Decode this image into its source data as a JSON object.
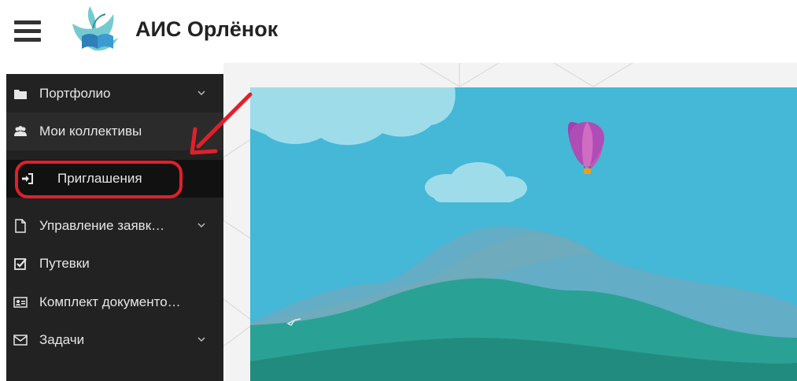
{
  "header": {
    "title": "АИС Орлёнок",
    "menu_icon": "hamburger-icon",
    "logo_icon": "app-logo-icon"
  },
  "sidebar": {
    "items": [
      {
        "label": "Портфолио",
        "icon": "folder-icon",
        "expandable": true
      },
      {
        "label": "Мои коллективы",
        "icon": "users-icon",
        "expandable": false
      },
      {
        "label": "Приглашения",
        "icon": "sign-in-icon",
        "expandable": false
      },
      {
        "label": "Управление заявк…",
        "icon": "file-icon",
        "expandable": true
      },
      {
        "label": "Путевки",
        "icon": "checkbox-icon",
        "expandable": false
      },
      {
        "label": "Комплект документо…",
        "icon": "id-card-icon",
        "expandable": false
      },
      {
        "label": "Задачи",
        "icon": "envelope-icon",
        "expandable": true
      }
    ]
  },
  "colors": {
    "sidebar_bg": "#222222",
    "highlight": "#e0202a",
    "sky": "#44b8d6"
  }
}
